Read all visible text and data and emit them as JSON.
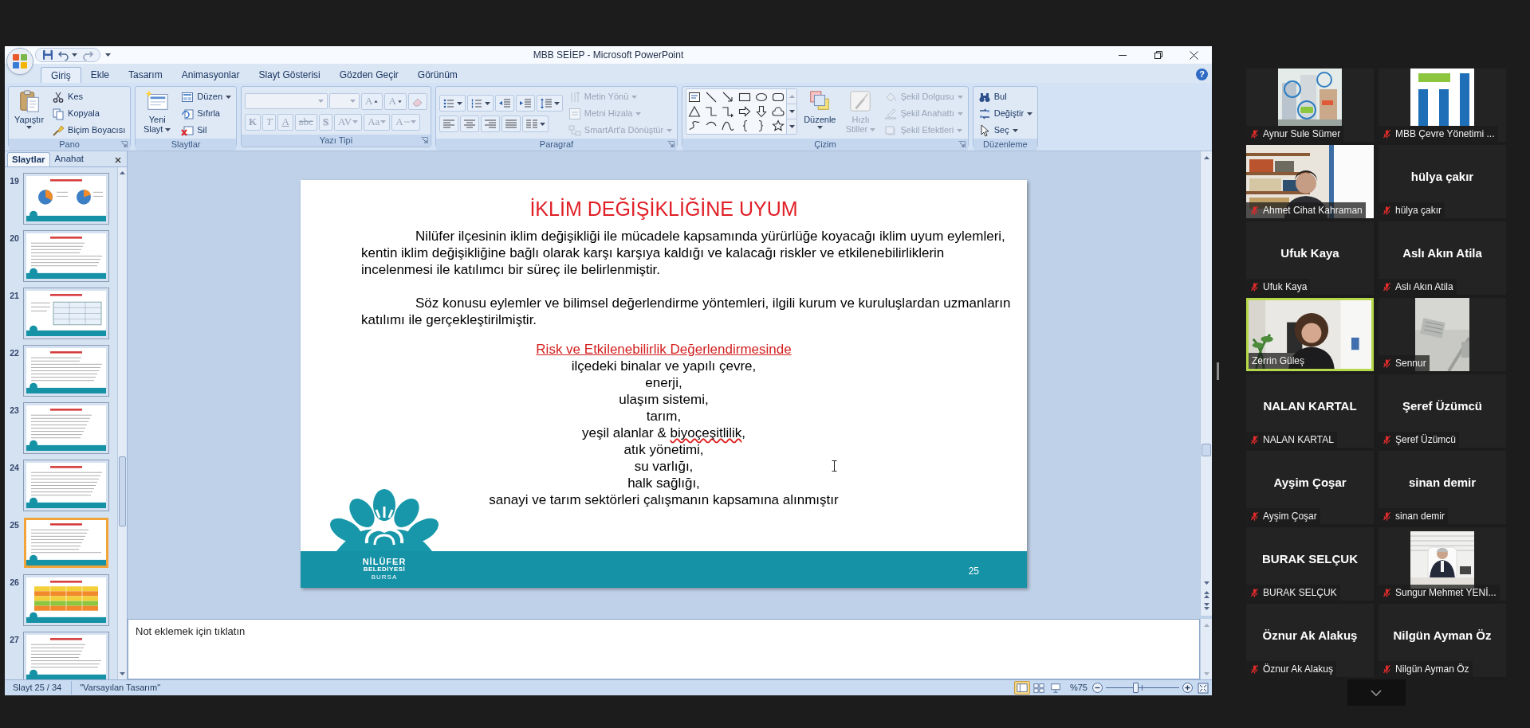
{
  "window": {
    "title": "MBB SEİEP - Microsoft PowerPoint",
    "help": "?"
  },
  "tabs": [
    {
      "label": "Giriş",
      "selected": true
    },
    {
      "label": "Ekle",
      "selected": false
    },
    {
      "label": "Tasarım",
      "selected": false
    },
    {
      "label": "Animasyonlar",
      "selected": false
    },
    {
      "label": "Slayt Gösterisi",
      "selected": false
    },
    {
      "label": "Gözden Geçir",
      "selected": false
    },
    {
      "label": "Görünüm",
      "selected": false
    }
  ],
  "ribbon": {
    "groups": [
      {
        "label": "Pano",
        "launcher": true,
        "columns": [
          [
            [
              {
                "kind": "large",
                "label": "Yapıştır",
                "dropdown": true,
                "disabled": false
              }
            ]
          ],
          [
            [
              {
                "kind": "small",
                "label": "Kes",
                "dropdown": false,
                "disabled": false
              }
            ],
            [
              {
                "kind": "small",
                "label": "Kopyala",
                "dropdown": false,
                "disabled": false
              }
            ],
            [
              {
                "kind": "small",
                "label": "Biçim Boyacısı",
                "dropdown": false,
                "disabled": false
              }
            ]
          ]
        ]
      },
      {
        "label": "Slaytlar",
        "launcher": false,
        "columns": [
          [
            [
              {
                "kind": "large",
                "label": "Yeni Slayt",
                "dropdown": true,
                "disabled": false
              }
            ]
          ],
          [
            [
              {
                "kind": "small",
                "label": "Düzen",
                "dropdown": true,
                "disabled": false
              }
            ],
            [
              {
                "kind": "small",
                "label": "Sıfırla",
                "dropdown": false,
                "disabled": false
              }
            ],
            [
              {
                "kind": "small",
                "label": "Sil",
                "dropdown": false,
                "disabled": false
              }
            ]
          ]
        ]
      },
      {
        "label": "Yazı Tipi",
        "launcher": true,
        "columns": [
          [
            [
              {
                "kind": "combo",
                "dropdown": true,
                "disabled": true
              },
              {
                "kind": "combo",
                "dropdown": true,
                "disabled": true
              },
              {
                "kind": "glyph",
                "label": "A",
                "dropdown": false,
                "disabled": true
              },
              {
                "kind": "glyph",
                "label": "A",
                "dropdown": false,
                "disabled": true
              },
              {
                "kind": "icon",
                "dropdown": false,
                "disabled": true
              }
            ],
            [
              {
                "kind": "glyph",
                "label": "K",
                "dropdown": false,
                "disabled": true
              },
              {
                "kind": "glyph",
                "label": "T",
                "dropdown": false,
                "disabled": true
              },
              {
                "kind": "glyph",
                "label": "A",
                "dropdown": false,
                "disabled": true
              },
              {
                "kind": "glyph",
                "label": "abc",
                "dropdown": false,
                "disabled": true
              },
              {
                "kind": "glyph",
                "label": "S",
                "dropdown": false,
                "disabled": true
              },
              {
                "kind": "glyph",
                "label": "AV",
                "dropdown": true,
                "disabled": true
              },
              {
                "kind": "glyph",
                "label": "Aa",
                "dropdown": true,
                "disabled": true
              },
              {
                "kind": "glyph",
                "label": "A",
                "dropdown": true,
                "disabled": true
              }
            ]
          ]
        ]
      },
      {
        "label": "Paragraf",
        "launcher": true,
        "columns": [
          [
            [
              {
                "kind": "icon",
                "dropdown": true,
                "disabled": false
              },
              {
                "kind": "icon",
                "dropdown": true,
                "disabled": false
              },
              {
                "kind": "icon",
                "dropdown": false,
                "disabled": false
              },
              {
                "kind": "icon",
                "dropdown": false,
                "disabled": false
              },
              {
                "kind": "icon",
                "dropdown": true,
                "disabled": false
              }
            ],
            [
              {
                "kind": "icon",
                "dropdown": false,
                "disabled": false
              },
              {
                "kind": "icon",
                "dropdown": false,
                "disabled": false
              },
              {
                "kind": "icon",
                "dropdown": false,
                "disabled": false
              },
              {
                "kind": "icon",
                "dropdown": false,
                "disabled": false
              },
              {
                "kind": "icon",
                "dropdown": true,
                "disabled": false
              }
            ]
          ],
          [
            [
              {
                "kind": "small",
                "label": "Metin Yönü",
                "dropdown": true,
                "disabled": true
              }
            ],
            [
              {
                "kind": "small",
                "label": "Metni Hizala",
                "dropdown": true,
                "disabled": true
              }
            ],
            [
              {
                "kind": "small",
                "label": "SmartArt'a Dönüştür",
                "dropdown": true,
                "disabled": true
              }
            ]
          ]
        ]
      },
      {
        "label": "Çizim",
        "launcher": true,
        "columns": [
          [
            [
              {
                "kind": "gallery",
                "dropdown": true,
                "disabled": false
              }
            ]
          ],
          [
            [
              {
                "kind": "large",
                "label": "Düzenle",
                "dropdown": true,
                "disabled": false
              }
            ]
          ],
          [
            [
              {
                "kind": "large",
                "label": "Hızlı Stiller",
                "dropdown": true,
                "disabled": true
              }
            ]
          ],
          [
            [
              {
                "kind": "small",
                "label": "Şekil Dolgusu",
                "dropdown": true,
                "disabled": true
              }
            ],
            [
              {
                "kind": "small",
                "label": "Şekil Anahattı",
                "dropdown": true,
                "disabled": true
              }
            ],
            [
              {
                "kind": "small",
                "label": "Şekil Efektleri",
                "dropdown": true,
                "disabled": true
              }
            ]
          ]
        ]
      },
      {
        "label": "Düzenleme",
        "launcher": false,
        "columns": [
          [
            [
              {
                "kind": "small",
                "label": "Bul",
                "dropdown": false,
                "disabled": false
              }
            ],
            [
              {
                "kind": "small",
                "label": "Değiştir",
                "dropdown": true,
                "disabled": false
              }
            ],
            [
              {
                "kind": "small",
                "label": "Seç",
                "dropdown": true,
                "disabled": false
              }
            ]
          ]
        ]
      }
    ]
  },
  "slides_panel": {
    "tabs": [
      {
        "label": "Slaytlar",
        "selected": true
      },
      {
        "label": "Anahat",
        "selected": false
      }
    ],
    "thumbnails": [
      {
        "number": "19",
        "selected": false
      },
      {
        "number": "20",
        "selected": false
      },
      {
        "number": "21",
        "selected": false
      },
      {
        "number": "22",
        "selected": false
      },
      {
        "number": "23",
        "selected": false
      },
      {
        "number": "24",
        "selected": false
      },
      {
        "number": "25",
        "selected": true
      },
      {
        "number": "26",
        "selected": false
      },
      {
        "number": "27",
        "selected": false
      }
    ]
  },
  "slide": {
    "title": "İKLİM DEĞİŞİKLİĞİNE UYUM",
    "paragraphs": [
      "Nilüfer ilçesinin iklim değişikliği ile mücadele kapsamında yürürlüğe koyacağı iklim uyum eylemleri, kentin iklim değişikliğine bağlı olarak karşı karşıya kaldığı ve kalacağı riskler ve etkilenebilirliklerin incelenmesi ile katılımcı bir süreç ile belirlenmiştir.",
      "Söz konusu eylemler ve bilimsel değerlendirme yöntemleri, ilgili kurum ve kuruluşlardan uzmanların katılımı ile gerçekleştirilmiştir."
    ],
    "subheading": "Risk ve Etkilenebilirlik Değerlendirmesinde",
    "list": [
      {
        "text": "ilçedeki binalar ve yapılı çevre,"
      },
      {
        "text": "enerji,"
      },
      {
        "text": "ulaşım sistemi,"
      },
      {
        "text": "tarım,"
      },
      {
        "parts": [
          {
            "text": "yeşil alanlar & ",
            "misspelled": false
          },
          {
            "text": "biyoçeşitlilik",
            "misspelled": true
          },
          {
            "text": ",",
            "misspelled": false
          }
        ]
      },
      {
        "text": "atık yönetimi,"
      },
      {
        "text": "su varlığı,"
      },
      {
        "text": "halk sağlığı,"
      },
      {
        "text": "sanayi ve tarım sektörleri çalışmanın kapsamına alınmıştır"
      }
    ],
    "logo_lines": [
      "NİLÜFER",
      "BELEDİYESİ",
      "BURSA"
    ],
    "page_number": "25"
  },
  "notes": {
    "placeholder": "Not eklemek için tıklatın"
  },
  "status_bar": {
    "slide_info": "Slayt 25 / 34",
    "theme": "\"Varsayılan Tasarım\"",
    "views": [
      {
        "selected": true
      },
      {
        "selected": false
      },
      {
        "selected": false
      }
    ],
    "zoom": "%75",
    "zoom_slider": {
      "level": 0.4
    }
  },
  "participants": [
    {
      "name": "Aynur Sule Sümer",
      "kind": "picture",
      "muted": true,
      "speaking": false
    },
    {
      "name": "MBB Çevre Yönetimi ...",
      "kind": "picture",
      "muted": true,
      "speaking": false
    },
    {
      "name": "Ahmet Cihat Kahraman",
      "kind": "video",
      "muted": true,
      "speaking": false
    },
    {
      "name": "hülya çakır",
      "kind": "name",
      "center_name": "hülya çakır",
      "muted": true,
      "speaking": false
    },
    {
      "name": "Ufuk Kaya",
      "kind": "name",
      "center_name": "Ufuk Kaya",
      "muted": true,
      "speaking": false
    },
    {
      "name": "Aslı Akın Atila",
      "kind": "name",
      "center_name": "Aslı Akın Atila",
      "muted": true,
      "speaking": false
    },
    {
      "name": "Zerrin Güleş",
      "kind": "video",
      "muted": false,
      "speaking": true
    },
    {
      "name": "Sennur",
      "kind": "picture",
      "muted": true,
      "speaking": false
    },
    {
      "name": "NALAN KARTAL",
      "kind": "name",
      "center_name": "NALAN KARTAL",
      "muted": true,
      "speaking": false
    },
    {
      "name": "Şeref Üzümcü",
      "kind": "name",
      "center_name": "Şeref Üzümcü",
      "muted": true,
      "speaking": false
    },
    {
      "name": "Ayşim Çoşar",
      "kind": "name",
      "center_name": "Ayşim Çoşar",
      "muted": true,
      "speaking": false
    },
    {
      "name": "sinan demir",
      "kind": "name",
      "center_name": "sinan demir",
      "muted": true,
      "speaking": false
    },
    {
      "name": "BURAK SELÇUK",
      "kind": "name",
      "center_name": "BURAK SELÇUK",
      "muted": true,
      "speaking": false
    },
    {
      "name": "Sungur Mehmet YENİ...",
      "kind": "picture",
      "muted": true,
      "speaking": false
    },
    {
      "name": "Öznur Ak Alakuş",
      "kind": "name",
      "center_name": "Öznur Ak Alakuş",
      "muted": true,
      "speaking": false
    },
    {
      "name": "Nilgün Ayman Öz",
      "kind": "name",
      "center_name": "Nilgün Ayman Öz",
      "muted": true,
      "speaking": false
    }
  ]
}
